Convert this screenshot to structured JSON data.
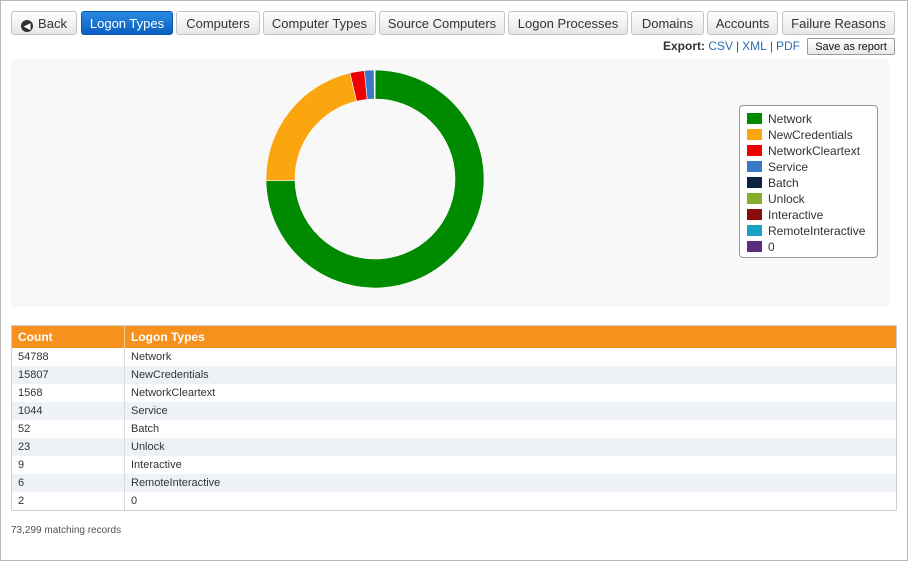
{
  "toolbar": {
    "back_label": "Back",
    "tabs": [
      "Logon Types",
      "Computers",
      "Computer Types",
      "Source Computers",
      "Logon Processes",
      "Domains",
      "Accounts",
      "Failure Reasons"
    ]
  },
  "export": {
    "label": "Export:",
    "csv": "CSV",
    "xml": "XML",
    "pdf": "PDF",
    "separator": "|"
  },
  "save_report_label": "Save as report",
  "chart_data": {
    "type": "pie",
    "categories": [
      "Network",
      "NewCredentials",
      "NetworkCleartext",
      "Service",
      "Batch",
      "Unlock",
      "Interactive",
      "RemoteInteractive",
      "0"
    ],
    "values": [
      54788,
      15807,
      1568,
      1044,
      52,
      23,
      9,
      6,
      2
    ],
    "colors": [
      "#008a00",
      "#fba50f",
      "#ee0000",
      "#3a78c8",
      "#0e2442",
      "#86b02b",
      "#8b0c0c",
      "#1aa1c3",
      "#5a2d7d"
    ],
    "donut": true,
    "legend_position": "right"
  },
  "table": {
    "headers": [
      "Count",
      "Logon Types"
    ],
    "rows": [
      [
        "54788",
        "Network"
      ],
      [
        "15807",
        "NewCredentials"
      ],
      [
        "1568",
        "NetworkCleartext"
      ],
      [
        "1044",
        "Service"
      ],
      [
        "52",
        "Batch"
      ],
      [
        "23",
        "Unlock"
      ],
      [
        "9",
        "Interactive"
      ],
      [
        "6",
        "RemoteInteractive"
      ],
      [
        "2",
        "0"
      ]
    ]
  },
  "footer": "73,299 matching records"
}
